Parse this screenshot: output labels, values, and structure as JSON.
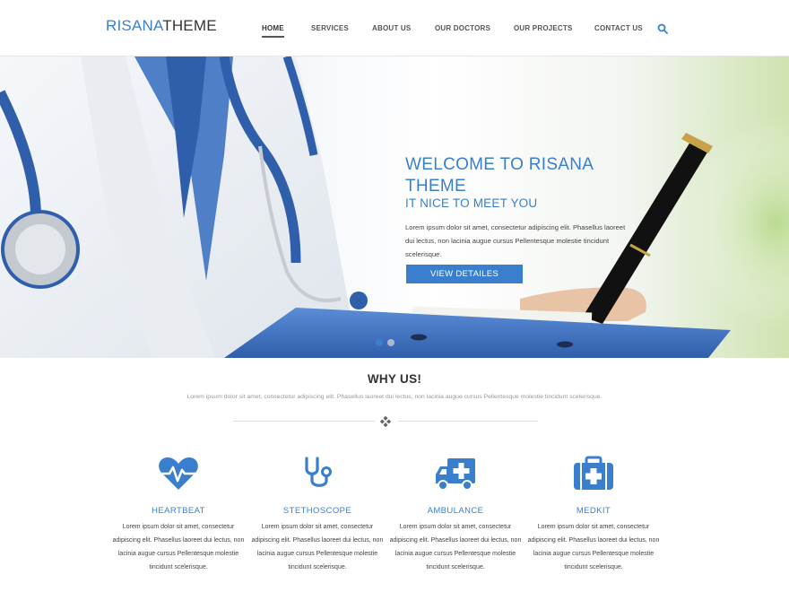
{
  "logo": {
    "part1": "RISANA",
    "part2": "THEME"
  },
  "nav": {
    "items": [
      "HOME",
      "SERVICES",
      "ABOUT US",
      "OUR DOCTORS",
      "OUR PROJECTS",
      "CONTACT US"
    ],
    "active": "HOME"
  },
  "hero": {
    "title": "WELCOME TO RISANA THEME",
    "subtitle": "IT NICE TO MEET YOU",
    "text": "Lorem ipsum dolor sit amet, consectetur adipiscing elit. Phasellus laoreet dui lectus, non lacinia augue cursus Pellentesque molestie tincidunt scelerisque.",
    "button": "VIEW DETAILES",
    "slide_count": 2,
    "active_slide": 1
  },
  "why": {
    "title": "WHY US!",
    "text": "Lorem ipsum dolor sit amet, consectetur adipiscing elit. Phasellus laoreet dui lectus, non lacinia augue cursus Pellentesque molestie tincidunt scelerisque."
  },
  "features": [
    {
      "icon": "heartbeat-icon",
      "title": "HEARTBEAT",
      "text": "Lorem ipsum dolor sit amet, consectetur adipiscing elit. Phasellus laoreet dui lectus, non lacinia augue cursus Pellentesque molestie tincidunt scelerisque."
    },
    {
      "icon": "stethoscope-icon",
      "title": "STETHOSCOPE",
      "text": "Lorem ipsum dolor sit amet, consectetur adipiscing elit. Phasellus laoreet dui lectus, non lacinia augue cursus Pellentesque molestie tincidunt scelerisque."
    },
    {
      "icon": "ambulance-icon",
      "title": "AMBULANCE",
      "text": "Lorem ipsum dolor sit amet, consectetur adipiscing elit. Phasellus laoreet dui lectus, non lacinia augue cursus Pellentesque molestie tincidunt scelerisque."
    },
    {
      "icon": "medkit-icon",
      "title": "MEDKIT",
      "text": "Lorem ipsum dolor sit amet, consectetur adipiscing elit. Phasellus laoreet dui lectus, non lacinia augue cursus Pellentesque molestie tincidunt scelerisque."
    }
  ],
  "colors": {
    "accent": "#3a7fce",
    "text": "#333333",
    "muted": "#999999"
  }
}
